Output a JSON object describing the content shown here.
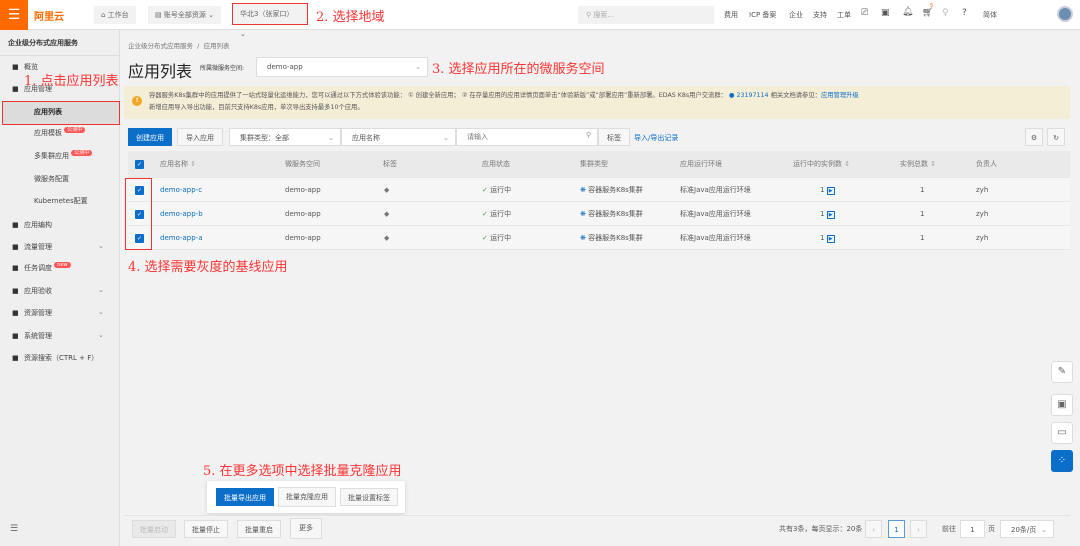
{
  "topbar": {
    "menu_icon": "hamburger-icon",
    "logo": "阿里云",
    "workbench": "工作台",
    "resources": "账号全部资源",
    "region": "华北3（张家口）",
    "search_placeholder": "搜索...",
    "nav": [
      "费用",
      "ICP 备案",
      "企业",
      "支持",
      "工单"
    ],
    "lang": "简体",
    "cart_count": "5"
  },
  "annotations": {
    "a1": "1. 点击应用列表",
    "a2": "2. 选择地域",
    "a3": "3. 选择应用所在的微服务空间",
    "a4": "4. 选择需要灰度的基线应用",
    "a5": "5. 在更多选项中选择批量克隆应用"
  },
  "sidebar": {
    "title": "企业级分布式应用服务",
    "items": [
      {
        "label": "概览",
        "icon": "home-icon"
      },
      {
        "label": "应用管理",
        "icon": "apps-icon"
      },
      {
        "label": "应用列表",
        "sub": true,
        "active": true
      },
      {
        "label": "应用模板",
        "sub": true,
        "badge": "公测中"
      },
      {
        "label": "多集群应用",
        "sub": true,
        "badge": "公测中"
      },
      {
        "label": "微服务配置",
        "sub": true
      },
      {
        "label": "Kubernetes配置",
        "sub": true
      },
      {
        "label": "应用编构",
        "icon": "layers-icon"
      },
      {
        "label": "流量管理",
        "icon": "traffic-icon",
        "chevron": true
      },
      {
        "label": "任务调度",
        "icon": "schedule-icon",
        "badge": "new"
      },
      {
        "label": "应用验收",
        "icon": "acceptance-icon",
        "chevron": true
      },
      {
        "label": "资源管理",
        "icon": "folder-icon",
        "chevron": true
      },
      {
        "label": "系统管理",
        "icon": "gear-icon",
        "chevron": true
      },
      {
        "label": "资源搜索（CTRL + F）",
        "icon": "search-list-icon"
      }
    ]
  },
  "main": {
    "breadcrumb": [
      "企业级分布式应用服务",
      "应用列表"
    ],
    "title": "应用列表",
    "namespace_label": "所属微服务空间:",
    "namespace_value": "demo-app",
    "alert": {
      "line1": "容器服务K8s集群中的应用提供了一站式轻量化运维能力，您可以通过以下方式体验该功能： ① 创建全新应用； ② 在存量应用的应用详情页面单击“体验新版”或“部署应用”重新部署。EDAS K8s用户交流群：",
      "group": "23197114",
      "line1b": "相关文档请参见：",
      "doc_link": "应用管理升级",
      "line2": "新增应用导入导出功能，目前只支持K8s应用，单次导出支持最多10个应用。"
    },
    "toolbar": {
      "create": "创建应用",
      "import": "导入应用",
      "cluster_type": "集群类型：全部",
      "field": "应用名称",
      "search_placeholder": "请输入",
      "tag": "标签",
      "records": "导入/导出记录"
    },
    "columns": [
      "应用名称",
      "微服务空间",
      "标签",
      "应用状态",
      "集群类型",
      "应用运行环境",
      "运行中的实例数",
      "实例总数",
      "负责人"
    ],
    "rows": [
      {
        "name": "demo-app-c",
        "ns": "demo-app",
        "status": "运行中",
        "cluster": "容器服务K8s集群",
        "env": "标准Java应用运行环境",
        "running": "1",
        "total": "1",
        "owner": "zyh"
      },
      {
        "name": "demo-app-b",
        "ns": "demo-app",
        "status": "运行中",
        "cluster": "容器服务K8s集群",
        "env": "标准Java应用运行环境",
        "running": "1",
        "total": "1",
        "owner": "zyh"
      },
      {
        "name": "demo-app-a",
        "ns": "demo-app",
        "status": "运行中",
        "cluster": "容器服务K8s集群",
        "env": "标准Java应用运行环境",
        "running": "1",
        "total": "1",
        "owner": "zyh"
      }
    ],
    "popover": {
      "export": "批量导出应用",
      "clone": "批量克隆应用",
      "tags": "批量设置标签"
    },
    "footer": {
      "start": "批量启动",
      "stop": "批量停止",
      "restart": "批量重启",
      "more": "更多",
      "summary": "共有3条，每页显示：20条",
      "page": "1",
      "goto": "前往",
      "goto_value": "1",
      "page_unit": "页",
      "page_size": "20条/页"
    }
  },
  "colors": {
    "accent": "#0b6ec9",
    "brand": "#ff6a00",
    "annotation": "#ee3333"
  }
}
